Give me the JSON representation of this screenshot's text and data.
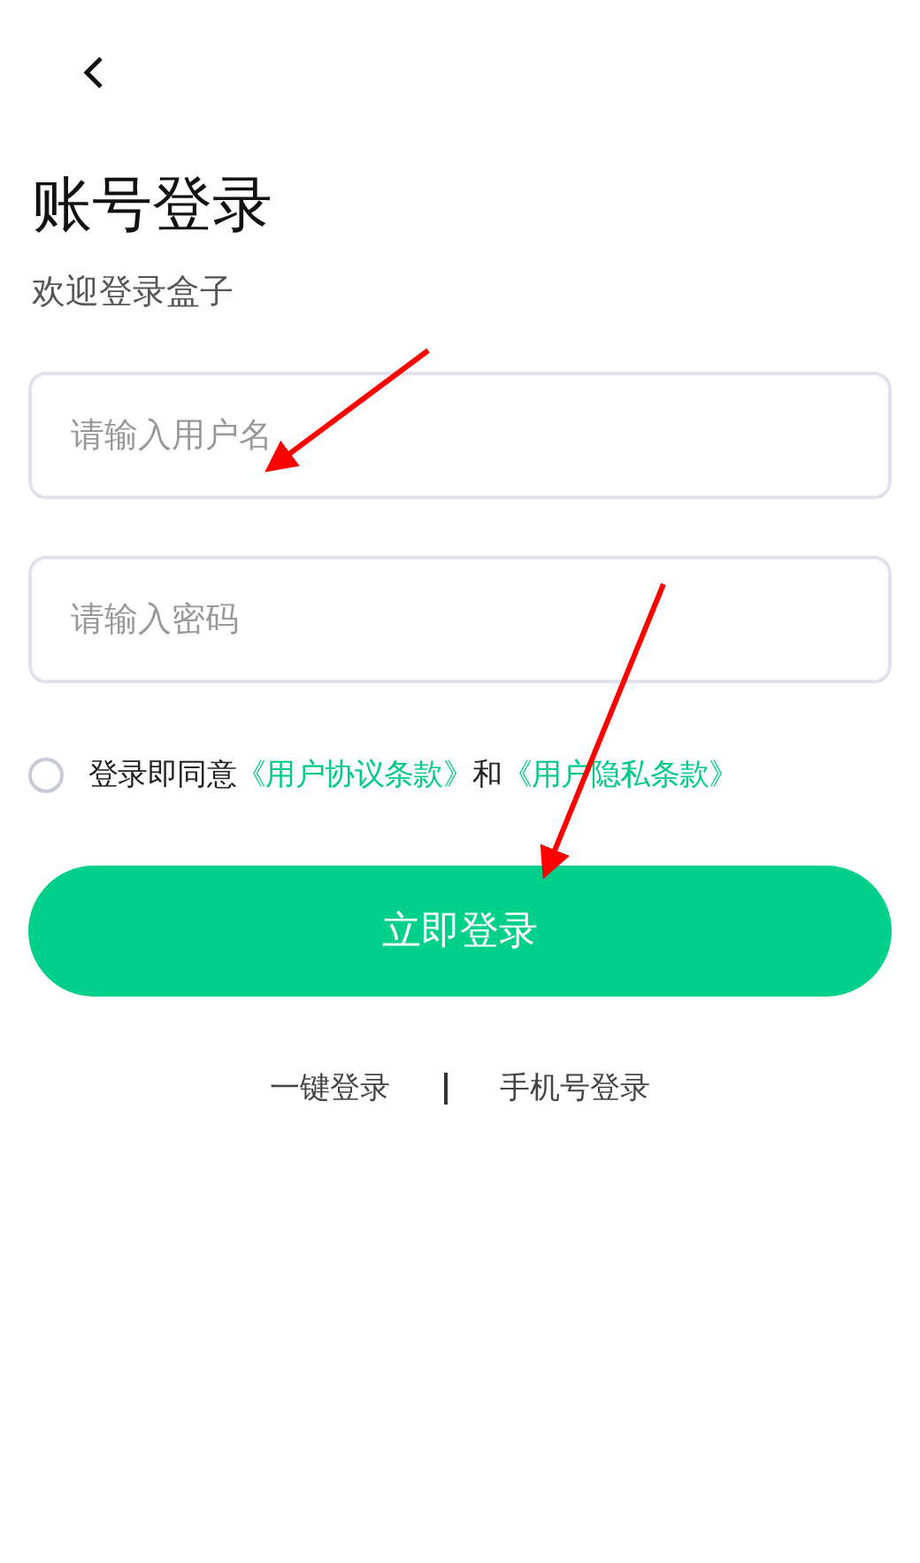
{
  "title": "账号登录",
  "subtitle": "欢迎登录盒子",
  "fields": [
    {
      "placeholder": "请输入用户名"
    },
    {
      "placeholder": "请输入密码"
    }
  ],
  "agreement": {
    "checked": false,
    "parts": [
      {
        "kind": "text",
        "text": "登录即同意"
      },
      {
        "kind": "link",
        "text": "《用户协议条款》"
      },
      {
        "kind": "text",
        "text": "和"
      },
      {
        "kind": "link",
        "text": "《用户隐私条款》"
      }
    ]
  },
  "login_button": "立即登录",
  "alt_logins": [
    "一键登录",
    "手机号登录"
  ]
}
